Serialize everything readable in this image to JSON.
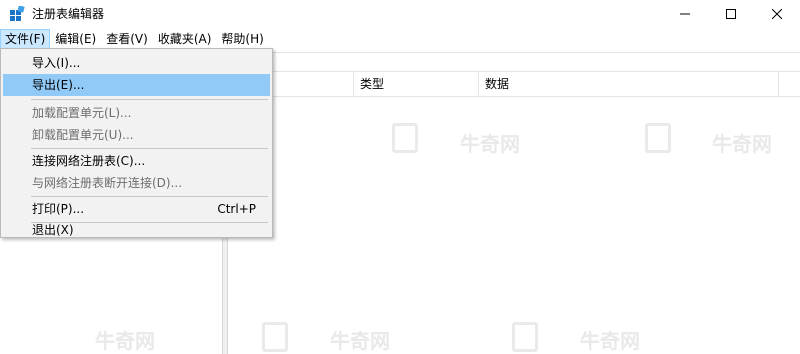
{
  "window": {
    "title": "注册表编辑器",
    "icon": "registry-editor-icon"
  },
  "caption_buttons": {
    "minimize_icon": "minimize-icon",
    "maximize_icon": "maximize-icon",
    "close_icon": "close-icon"
  },
  "menubar": {
    "items": [
      {
        "label": "文件(F)",
        "active": true
      },
      {
        "label": "编辑(E)",
        "active": false
      },
      {
        "label": "查看(V)",
        "active": false
      },
      {
        "label": "收藏夹(A)",
        "active": false
      },
      {
        "label": "帮助(H)",
        "active": false
      }
    ]
  },
  "list": {
    "columns": [
      "类型",
      "数据"
    ]
  },
  "file_menu": {
    "items": [
      {
        "label": "导入(I)...",
        "enabled": true,
        "highlighted": false
      },
      {
        "label": "导出(E)...",
        "enabled": true,
        "highlighted": true
      },
      {
        "label": "加载配置单元(L)...",
        "enabled": false,
        "highlighted": false
      },
      {
        "label": "卸载配置单元(U)...",
        "enabled": false,
        "highlighted": false
      },
      {
        "label": "连接网络注册表(C)...",
        "enabled": true,
        "highlighted": false
      },
      {
        "label": "与网络注册表断开连接(D)...",
        "enabled": false,
        "highlighted": false
      },
      {
        "label": "打印(P)...",
        "enabled": true,
        "highlighted": false,
        "shortcut": "Ctrl+P"
      },
      {
        "label": "退出(X)",
        "enabled": true,
        "highlighted": false
      }
    ]
  },
  "watermark": {
    "text": "牛奇网"
  },
  "colors": {
    "menu_active_bg": "#cce8ff",
    "menu_highlight_bg": "#91c9f7",
    "dropdown_bg": "#f2f2f2",
    "disabled_text": "#6d6d6d",
    "icon_blue": "#1a73c7"
  }
}
